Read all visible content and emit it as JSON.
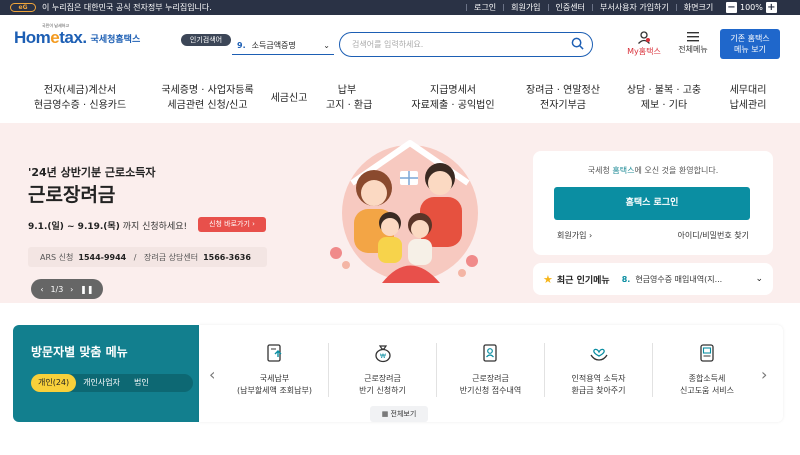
{
  "topbar": {
    "gov_text": "이 누리집은 대한민국 공식 전자정부 누리집입니다.",
    "eg_badge": "eG",
    "links": [
      "로그인",
      "회원가입",
      "인증센터",
      "부서사용자 가입하기",
      "화면크기"
    ],
    "zoom_minus": "−",
    "zoom_value": "100%",
    "zoom_plus": "+"
  },
  "header": {
    "logo_small": "국민이 납세하고",
    "logo_name_a": "Hom",
    "logo_name_b": "e",
    "logo_name_c": "tax.",
    "logo_sub": "국세청홈택스",
    "popular_label": "인기검색어",
    "popular_num": "9.",
    "popular_item": "소득금액증명",
    "search_placeholder": "검색어를 입력하세요.",
    "my_home": "My홈택스",
    "all_menu": "전체메뉴",
    "old_home_line1": "기존 홈택스",
    "old_home_line2": "메뉴 보기"
  },
  "gnb": [
    {
      "l1": "전자(세금)계산서",
      "l2": "현금영수증 · 신용카드"
    },
    {
      "l1": "국세증명 · 사업자등록",
      "l2": "세금관련 신청/신고"
    },
    {
      "l1": "세금신고",
      "l2": ""
    },
    {
      "l1": "납부",
      "l2": "고지 · 환급"
    },
    {
      "l1": "지급명세서",
      "l2": "자료제출 · 공익법인"
    },
    {
      "l1": "장려금 · 연말정산",
      "l2": "전자기부금"
    },
    {
      "l1": "상담 · 불복 · 고충",
      "l2": "제보 · 기타"
    },
    {
      "l1": "세무대리",
      "l2": "납세관리"
    }
  ],
  "hero": {
    "line1": "'24년 상반기분 근로소득자",
    "line2": "근로장려금",
    "period": "9.1.(일) ~ 9.19.(목)",
    "period_suffix": "까지 신청하세요!",
    "apply_btn": "신청 바로가기",
    "ars_label": "ARS 신청",
    "ars_num": "1544-9944",
    "center_label": "장려금 상담센터",
    "center_num": "1566-3636",
    "slide_counter": "1/3"
  },
  "login": {
    "welcome_a": "국세청 ",
    "welcome_b": "홈택스",
    "welcome_c": "에 오신 것을 환영합니다.",
    "button": "홈택스 로그인",
    "join": "회원가입",
    "find": "아이디/비밀번호 찾기"
  },
  "popular_menu": {
    "label": "최근 인기메뉴",
    "num": "8.",
    "item": "현금영수증 매입내역(지..."
  },
  "visitor": {
    "title": "방문자별 맞춤 메뉴",
    "tabs": [
      "개인(24)",
      "개인사업자",
      "법인"
    ]
  },
  "services": [
    {
      "l1": "국세납부",
      "l2": "(납부할세액 조회납부)",
      "icon": "doc-upload-icon"
    },
    {
      "l1": "근로장려금",
      "l2": "반기 신청하기",
      "icon": "money-bag-icon"
    },
    {
      "l1": "근로장려금",
      "l2": "반기신청 접수내역",
      "icon": "doc-person-icon"
    },
    {
      "l1": "인적용역 소득자",
      "l2": "환급금 찾아주기",
      "icon": "heart-hands-icon"
    },
    {
      "l1": "종합소득세",
      "l2": "신고도움 서비스",
      "icon": "tablet-icon"
    }
  ],
  "all_view": "전체보기",
  "colors": {
    "brand_blue": "#1d5fb4",
    "teal": "#0b8ea2",
    "hero_bg": "#fbeeed",
    "apply_red": "#e8504b"
  }
}
